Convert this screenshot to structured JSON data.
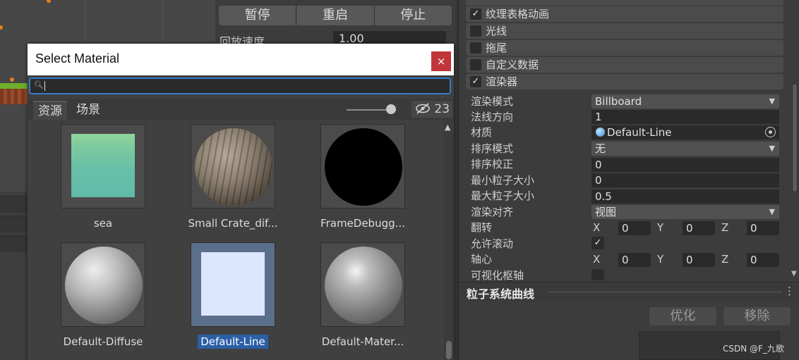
{
  "playback": {
    "buttons": [
      "暂停",
      "重启",
      "停止"
    ],
    "speed_label": "回放速度",
    "speed_value": "1.00"
  },
  "modules": [
    {
      "label": "纹理表格动画",
      "checked": true
    },
    {
      "label": "光线",
      "checked": false
    },
    {
      "label": "拖尾",
      "checked": false
    },
    {
      "label": "自定义数据",
      "checked": false
    },
    {
      "label": "渲染器",
      "checked": true
    }
  ],
  "renderer": {
    "render_mode_label": "渲染模式",
    "render_mode": "Billboard",
    "normal_dir_label": "法线方向",
    "normal_dir": "1",
    "material_label": "材质",
    "material": "Default-Line",
    "sort_mode_label": "排序模式",
    "sort_mode": "无",
    "sort_fudge_label": "排序校正",
    "sort_fudge": "0",
    "min_size_label": "最小粒子大小",
    "min_size": "0",
    "max_size_label": "最大粒子大小",
    "max_size": "0.5",
    "align_label": "渲染对齐",
    "align": "视图",
    "flip_label": "翻转",
    "flip": {
      "x": "0",
      "y": "0",
      "z": "0"
    },
    "allow_roll_label": "允许滚动",
    "allow_roll": true,
    "pivot_label": "轴心",
    "pivot": {
      "x": "0",
      "y": "0",
      "z": "0"
    },
    "visualize_pivot_label": "可视化枢轴"
  },
  "axes": {
    "x": "X",
    "y": "Y",
    "z": "Z"
  },
  "curves": {
    "title": "粒子系统曲线",
    "optimize": "优化",
    "remove": "移除"
  },
  "dialog": {
    "title": "Select Material",
    "close": "×",
    "tabs": [
      "资源",
      "场景"
    ],
    "hidden_count": "23",
    "items": [
      {
        "name": "sea"
      },
      {
        "name": "Small Crate_dif..."
      },
      {
        "name": "FrameDebugg..."
      },
      {
        "name": "Default-Diffuse"
      },
      {
        "name": "Default-Line",
        "selected": true
      },
      {
        "name": "Default-Mater..."
      }
    ]
  },
  "watermark": "CSDN @F_九歌",
  "colors": {
    "accent": "#3a79c5",
    "selection": "#2b5fa6",
    "close": "#c0353a"
  }
}
